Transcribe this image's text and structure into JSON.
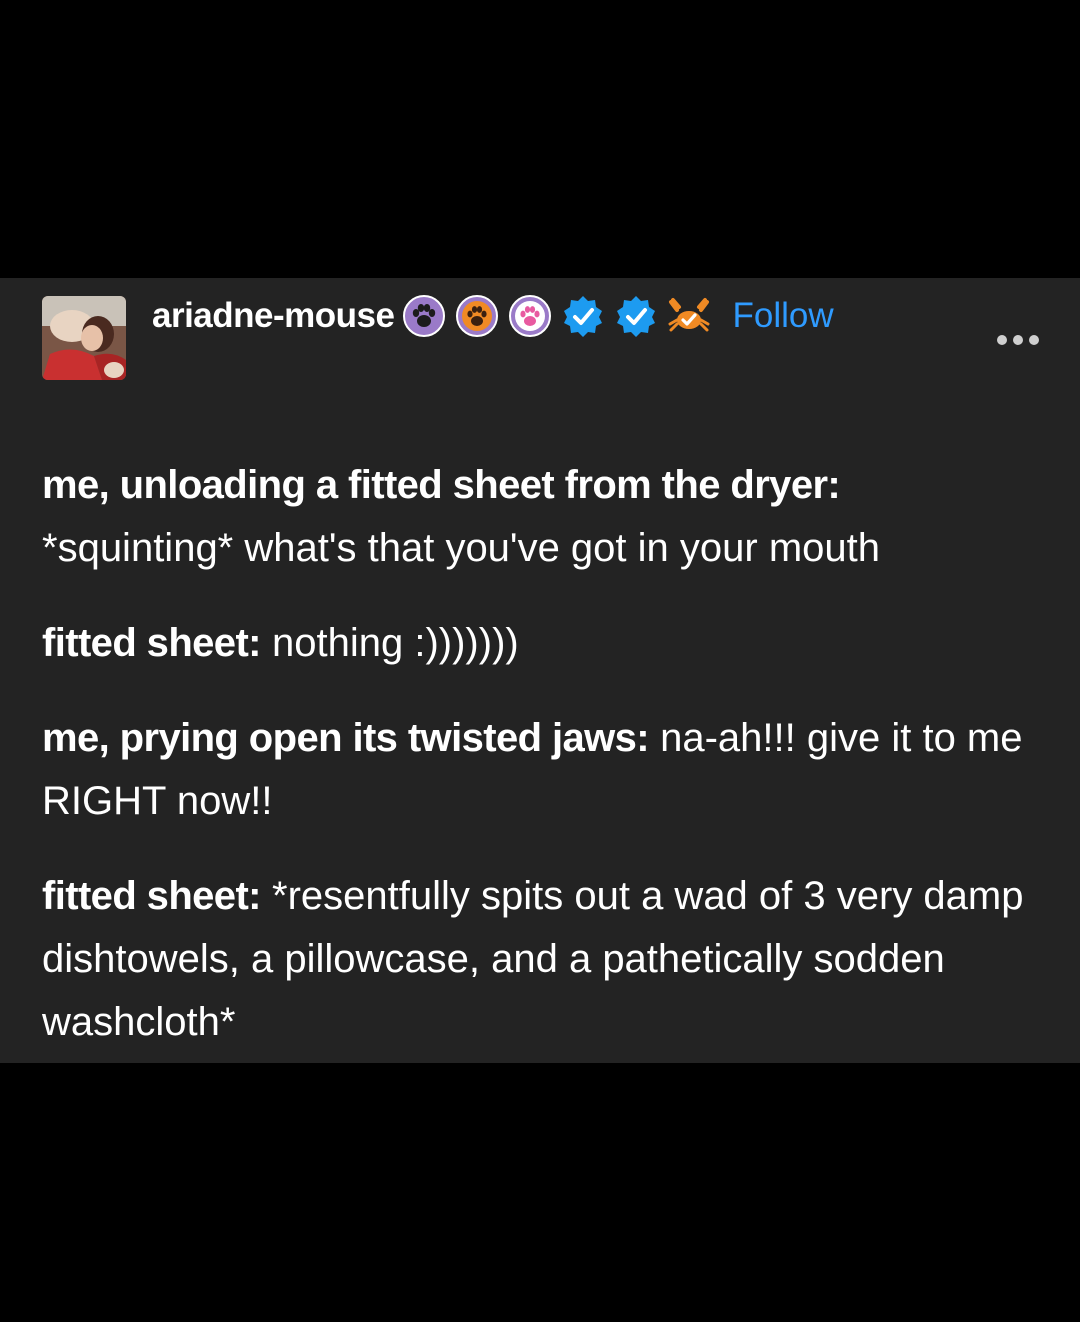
{
  "post": {
    "username": "ariadne-mouse",
    "follow_label": "Follow",
    "badges": [
      "paw-badge-icon",
      "paw-badge-icon",
      "paw-badge-icon",
      "verified-check-icon",
      "verified-check-icon",
      "crab-badge-icon"
    ],
    "colors": {
      "background": "#232323",
      "page": "#000000",
      "text": "#ffffff",
      "follow": "#2f9bff",
      "verified": "#1d9bf0"
    },
    "content": {
      "p1_speaker": "me, unloading a fitted sheet from the dryer:",
      "p1_line2": "*squinting* what's that you've got in your mouth",
      "p2_speaker": "fitted sheet:",
      "p2_text": " nothing :)))))))",
      "p3_speaker": "me, prying open its twisted jaws:",
      "p3_text": " na-ah!!! give it to me RIGHT now!!",
      "p4_speaker": "fitted sheet:",
      "p4_text": " *resentfully spits out a wad of 3 very damp dishtowels, a pillowcase, and a pathetically sodden washcloth*"
    }
  }
}
